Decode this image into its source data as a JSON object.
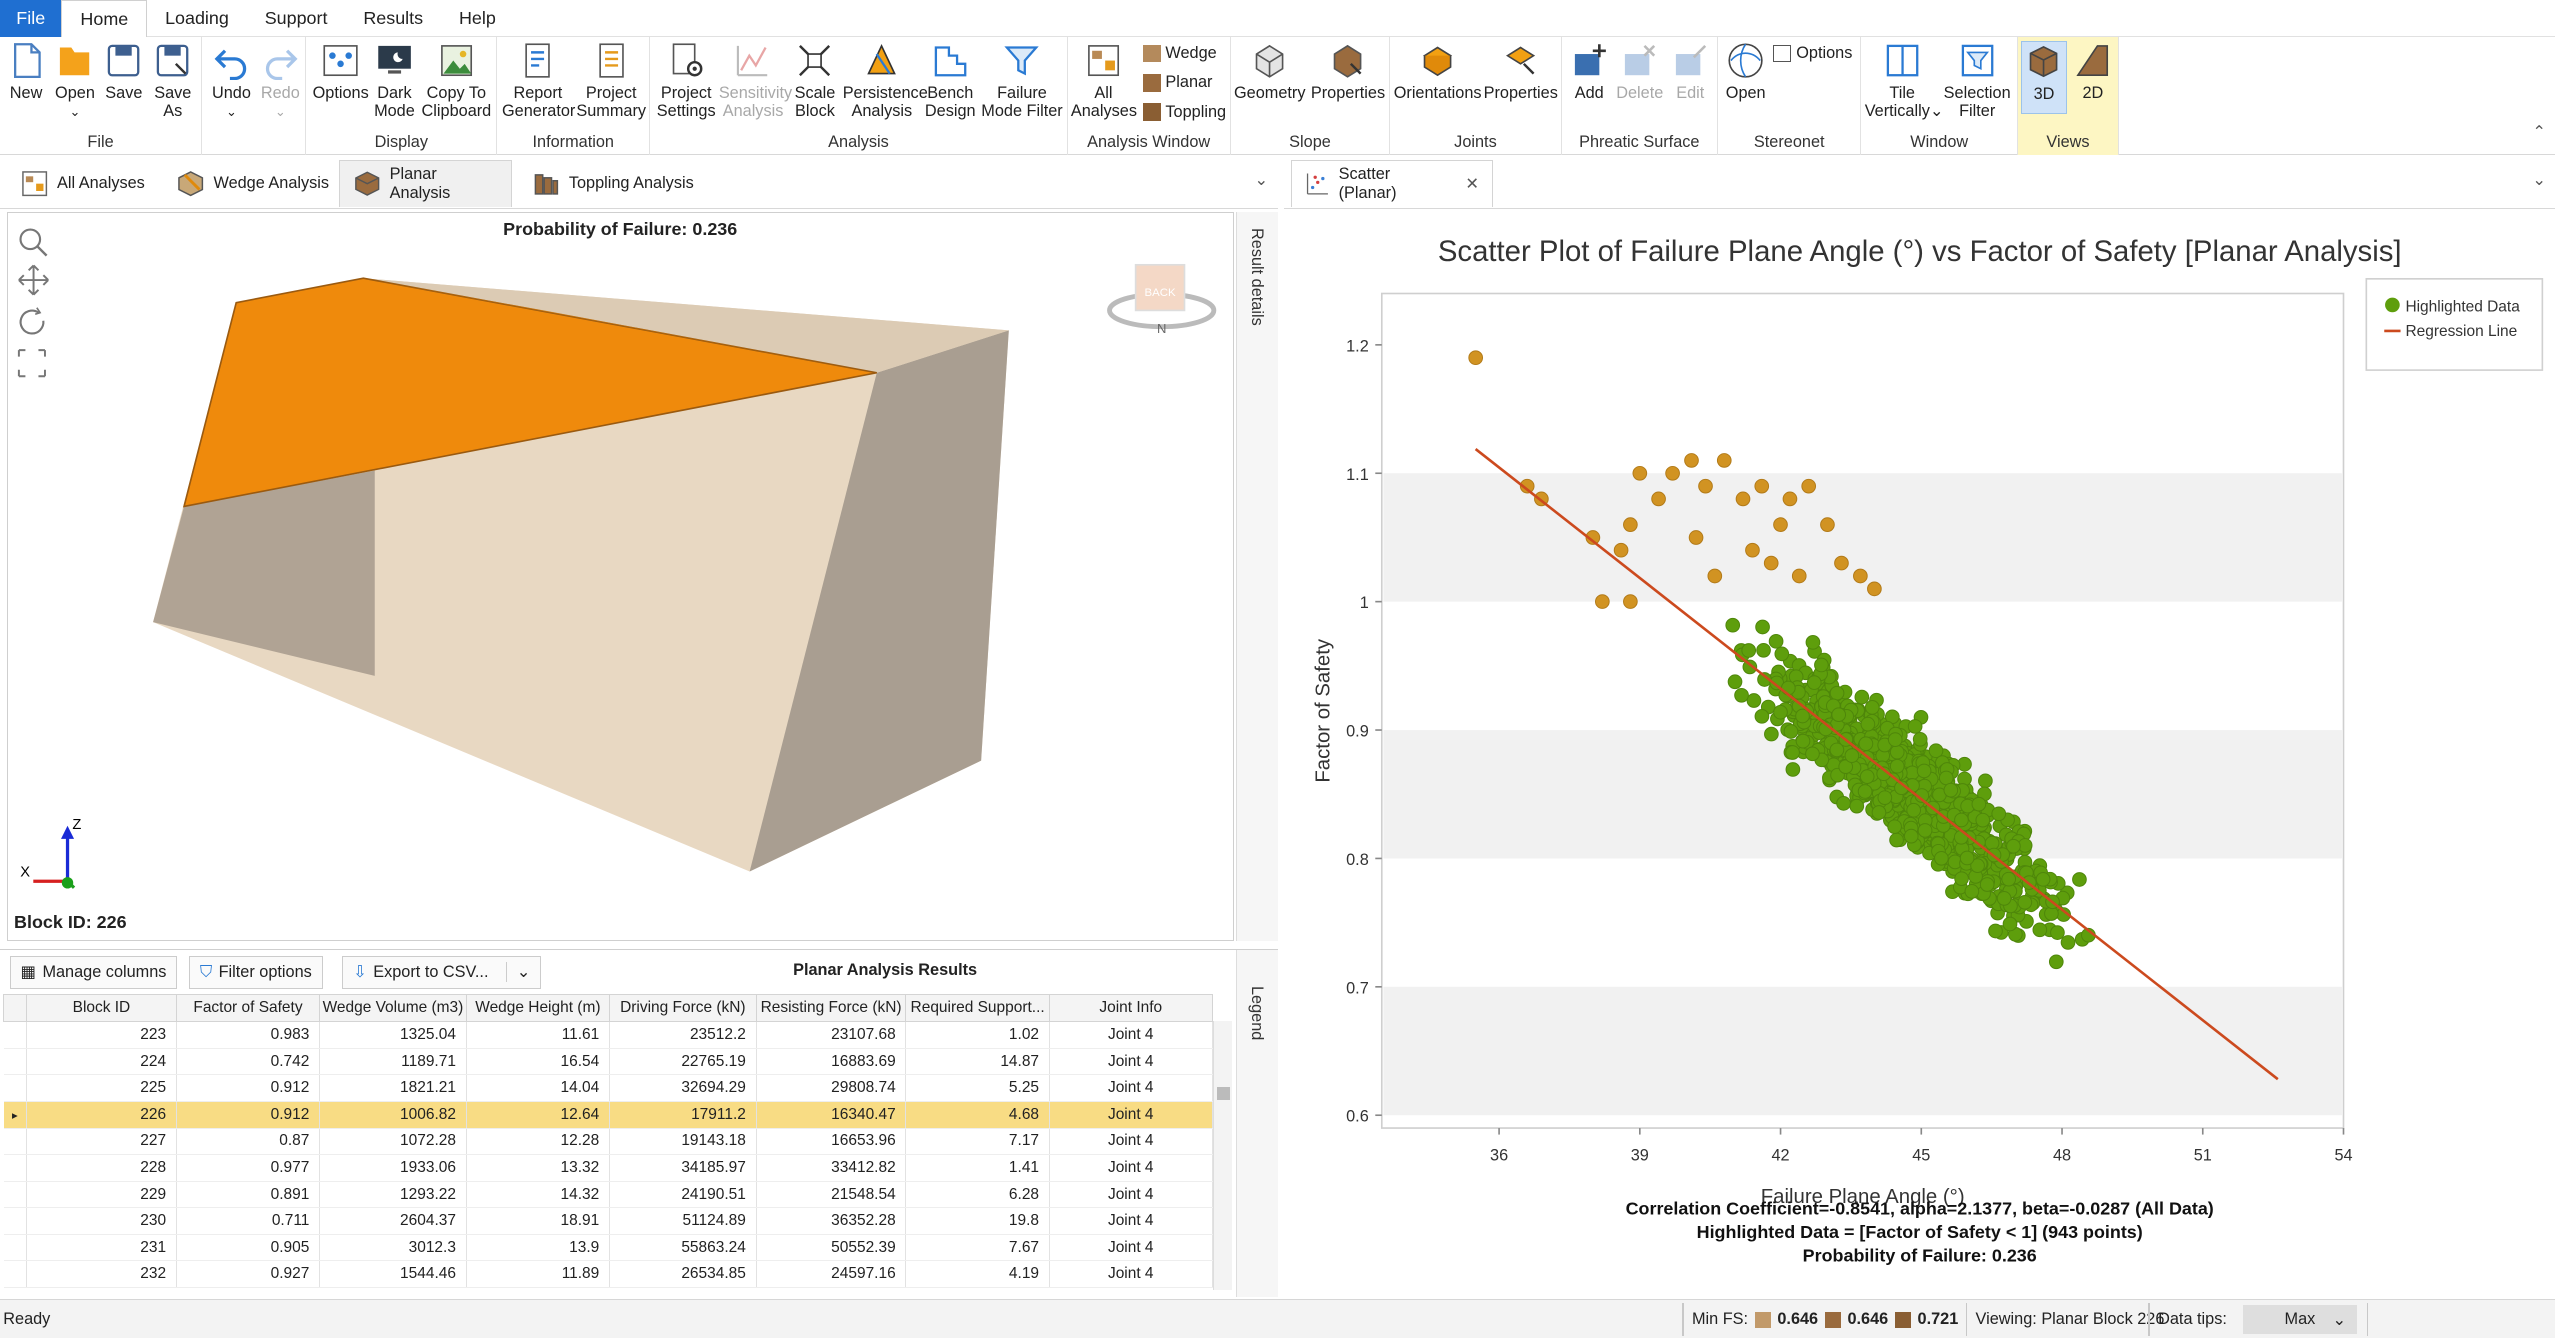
{
  "menu": {
    "items": [
      "File",
      "Home",
      "Loading",
      "Support",
      "Results",
      "Help"
    ]
  },
  "ribbon": {
    "file": {
      "label": "File",
      "new": "New",
      "open": "Open",
      "save": "Save",
      "save_as1": "Save",
      "save_as2": "As"
    },
    "edit": {
      "undo": "Undo",
      "redo": "Redo"
    },
    "display": {
      "label": "Display",
      "options": "Options",
      "dark1": "Dark",
      "dark2": "Mode",
      "copy1": "Copy To",
      "copy2": "Clipboard"
    },
    "information": {
      "label": "Information",
      "report1": "Report",
      "report2": "Generator",
      "summary1": "Project",
      "summary2": "Summary"
    },
    "analysis": {
      "label": "Analysis",
      "settings1": "Project",
      "settings2": "Settings",
      "sens1": "Sensitivity",
      "sens2": "Analysis",
      "scale1": "Scale",
      "scale2": "Block",
      "persist1": "Persistence",
      "persist2": "Analysis",
      "bench1": "Bench",
      "bench2": "Design",
      "fmf1": "Failure",
      "fmf2": "Mode Filter"
    },
    "analysis_window": {
      "label": "Analysis Window",
      "all1": "All",
      "all2": "Analyses",
      "wedge": "Wedge",
      "planar": "Planar",
      "toppling": "Toppling"
    },
    "slope": {
      "label": "Slope",
      "geometry": "Geometry",
      "properties": "Properties"
    },
    "joints": {
      "label": "Joints",
      "orientations": "Orientations",
      "properties": "Properties"
    },
    "phreatic": {
      "label": "Phreatic Surface",
      "add": "Add",
      "delete": "Delete",
      "edit": "Edit"
    },
    "stereonet": {
      "label": "Stereonet",
      "open": "Open",
      "options": "Options"
    },
    "window": {
      "label": "Window",
      "tile1": "Tile",
      "tile2": "Vertically",
      "sel1": "Selection",
      "sel2": "Filter"
    },
    "views": {
      "label": "Views",
      "v3d": "3D",
      "v2d": "2D"
    }
  },
  "left_tabs": [
    "All Analyses",
    "Wedge Analysis",
    "Planar Analysis",
    "Toppling Analysis"
  ],
  "right_tab": "Scatter (Planar)",
  "view3d": {
    "pof_title": "Probability of Failure: 0.236",
    "block_id": "Block ID: 226",
    "side_label": "Result details",
    "cube_label": "BACK",
    "axis_z": "Z",
    "axis_x": "X",
    "north": "N"
  },
  "table": {
    "manage": "Manage columns",
    "filter": "Filter options",
    "export": "Export to CSV...",
    "title": "Planar Analysis Results",
    "legend_label": "Legend",
    "headers": [
      "Block ID",
      "Factor of Safety",
      "Wedge Volume (m3)",
      "Wedge Height (m)",
      "Driving Force (kN)",
      "Resisting Force (kN)",
      "Required Support...",
      "Joint Info"
    ],
    "rows": [
      [
        "223",
        "0.983",
        "1325.04",
        "11.61",
        "23512.2",
        "23107.68",
        "1.02",
        "Joint 4"
      ],
      [
        "224",
        "0.742",
        "1189.71",
        "16.54",
        "22765.19",
        "16883.69",
        "14.87",
        "Joint 4"
      ],
      [
        "225",
        "0.912",
        "1821.21",
        "14.04",
        "32694.29",
        "29808.74",
        "5.25",
        "Joint 4"
      ],
      [
        "226",
        "0.912",
        "1006.82",
        "12.64",
        "17911.2",
        "16340.47",
        "4.68",
        "Joint 4"
      ],
      [
        "227",
        "0.87",
        "1072.28",
        "12.28",
        "19143.18",
        "16653.96",
        "7.17",
        "Joint 4"
      ],
      [
        "228",
        "0.977",
        "1933.06",
        "13.32",
        "34185.97",
        "33412.82",
        "1.41",
        "Joint 4"
      ],
      [
        "229",
        "0.891",
        "1293.22",
        "14.32",
        "24190.51",
        "21548.54",
        "6.28",
        "Joint 4"
      ],
      [
        "230",
        "0.711",
        "2604.37",
        "18.91",
        "51124.89",
        "36352.28",
        "19.8",
        "Joint 4"
      ],
      [
        "231",
        "0.905",
        "3012.3",
        "13.9",
        "55863.24",
        "50552.39",
        "7.67",
        "Joint 4"
      ],
      [
        "232",
        "0.927",
        "1544.46",
        "11.89",
        "26534.85",
        "24597.16",
        "4.19",
        "Joint 4"
      ]
    ],
    "selected_row": 3
  },
  "chart_data": {
    "type": "scatter",
    "title": "Scatter Plot of Failure Plane Angle (°) vs Factor of Safety [Planar Analysis]",
    "xlabel": "Failure Plane Angle (°)",
    "ylabel": "Factor of Safety",
    "xlim": [
      33.5,
      54
    ],
    "ylim": [
      0.59,
      1.24
    ],
    "xticks": [
      "36",
      "39",
      "42",
      "45",
      "48",
      "51",
      "54"
    ],
    "yticks": [
      "0.6",
      "0.7",
      "0.8",
      "0.9",
      "1",
      "1.1",
      "1.2"
    ],
    "legend": [
      "Highlighted Data",
      "Regression Line"
    ],
    "legend_position": "top-right",
    "colors": {
      "highlighted": "#5e9e0c",
      "other": "#d19322",
      "regression": "#cc4a1e"
    },
    "regression": {
      "alpha": 2.1377,
      "beta": -0.0287,
      "x_range": [
        35.5,
        52.6
      ]
    },
    "highlight_threshold": 1,
    "footer": [
      "Correlation Coefficient=-0.8541, alpha=2.1377, beta=-0.0287 (All Data)",
      "Highlighted Data = [Factor of Safety < 1] (943 points)",
      "Probability of Failure: 0.236"
    ],
    "series": [
      {
        "name": "Highlighted Data",
        "points": [
          [
            35.5,
            1.19
          ],
          [
            36.6,
            1.09
          ],
          [
            36.9,
            1.08
          ],
          [
            38.0,
            1.05
          ],
          [
            38.6,
            1.04
          ],
          [
            38.8,
            1.06
          ],
          [
            39.0,
            1.1
          ],
          [
            39.4,
            1.08
          ],
          [
            39.7,
            1.1
          ],
          [
            40.1,
            1.11
          ],
          [
            40.4,
            1.09
          ],
          [
            40.8,
            1.11
          ],
          [
            41.2,
            1.08
          ],
          [
            41.6,
            1.09
          ],
          [
            42.0,
            1.06
          ],
          [
            42.2,
            1.08
          ],
          [
            42.6,
            1.09
          ],
          [
            43.0,
            1.06
          ],
          [
            43.3,
            1.03
          ],
          [
            43.7,
            1.02
          ],
          [
            44.0,
            1.01
          ],
          [
            38.2,
            1.0
          ],
          [
            40.6,
            1.02
          ],
          [
            41.4,
            1.04
          ],
          [
            42.4,
            1.02
          ],
          [
            38.8,
            1.0
          ],
          [
            40.2,
            1.05
          ],
          [
            41.8,
            1.03
          ]
        ]
      }
    ]
  },
  "status": {
    "ready": "Ready",
    "min_fs": "Min FS:",
    "fs1": "0.646",
    "fs2": "0.646",
    "fs3": "0.721",
    "viewing": "Viewing: Planar Block 226",
    "datatips": "Data tips:",
    "max": "Max"
  }
}
